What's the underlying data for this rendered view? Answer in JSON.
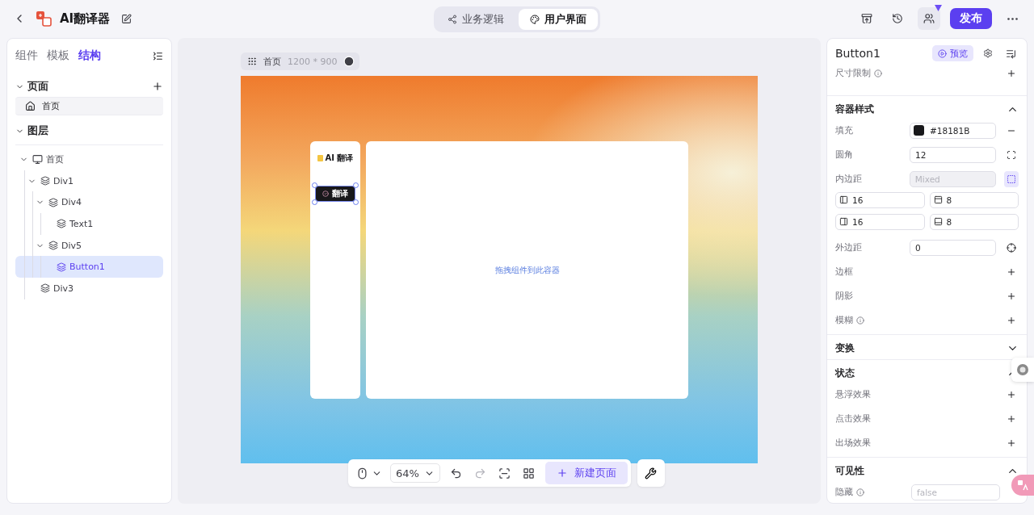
{
  "header": {
    "title": "AI翻译器",
    "mode_tabs": [
      {
        "label": "业务逻辑",
        "selected": false
      },
      {
        "label": "用户界面",
        "selected": true
      }
    ],
    "publish": "发布"
  },
  "left_panel": {
    "tabs": [
      {
        "label": "组件",
        "selected": false
      },
      {
        "label": "模板",
        "selected": false
      },
      {
        "label": "结构",
        "selected": true
      }
    ],
    "pages": {
      "title": "页面",
      "expanded": true,
      "items": [
        {
          "label": "首页",
          "selected": true
        }
      ]
    },
    "layers": {
      "title": "图层",
      "expanded": true,
      "tree": [
        {
          "label": "首页",
          "kind": "page",
          "expanded": true,
          "selected": false,
          "children": [
            {
              "label": "Div1",
              "kind": "layer",
              "expanded": true,
              "selected": false,
              "children": [
                {
                  "label": "Div4",
                  "kind": "layer",
                  "expanded": true,
                  "selected": false,
                  "children": [
                    {
                      "label": "Text1",
                      "kind": "layer",
                      "selected": false
                    }
                  ]
                },
                {
                  "label": "Div5",
                  "kind": "layer",
                  "expanded": true,
                  "selected": false,
                  "children": [
                    {
                      "label": "Button1",
                      "kind": "layer",
                      "selected": true
                    }
                  ]
                }
              ]
            },
            {
              "label": "Div3",
              "kind": "layer",
              "selected": false
            }
          ]
        }
      ]
    }
  },
  "canvas": {
    "page_label": "首页",
    "size": "1200 * 900",
    "app": {
      "brand": "AI 翻译",
      "button": "翻译",
      "drop_hint": "拖拽组件到此容器"
    }
  },
  "toolbar": {
    "zoom": "64%",
    "new_page": "新建页面"
  },
  "inspector": {
    "title": "Button1",
    "preview": "预览",
    "size_limit": {
      "label": "尺寸限制",
      "info": true
    },
    "sections": [
      {
        "title": "容器样式",
        "expanded": true,
        "rows": [
          {
            "kind": "color",
            "label": "填充",
            "value": "#18181B"
          },
          {
            "kind": "radius",
            "label": "圆角",
            "value": "12"
          },
          {
            "kind": "mixed",
            "label": "内边距",
            "placeholder": "Mixed"
          },
          {
            "kind": "padding",
            "values": [
              "16",
              "8",
              "16",
              "8"
            ]
          },
          {
            "kind": "margin",
            "label": "外边距",
            "value": "0"
          },
          {
            "kind": "add",
            "label": "边框",
            "info": false
          },
          {
            "kind": "add",
            "label": "阴影",
            "info": false
          },
          {
            "kind": "add",
            "label": "模糊",
            "info": true
          }
        ]
      },
      {
        "title": "变换",
        "expanded": false
      },
      {
        "title": "状态",
        "expanded": true,
        "rows": [
          {
            "kind": "add",
            "label": "悬浮效果",
            "info": false
          },
          {
            "kind": "add",
            "label": "点击效果",
            "info": false
          },
          {
            "kind": "add",
            "label": "出场效果",
            "info": false
          }
        ]
      },
      {
        "title": "可见性",
        "expanded": true,
        "rows": [
          {
            "kind": "hidden",
            "label": "隐藏",
            "info": true,
            "placeholder": "false"
          }
        ]
      }
    ]
  }
}
